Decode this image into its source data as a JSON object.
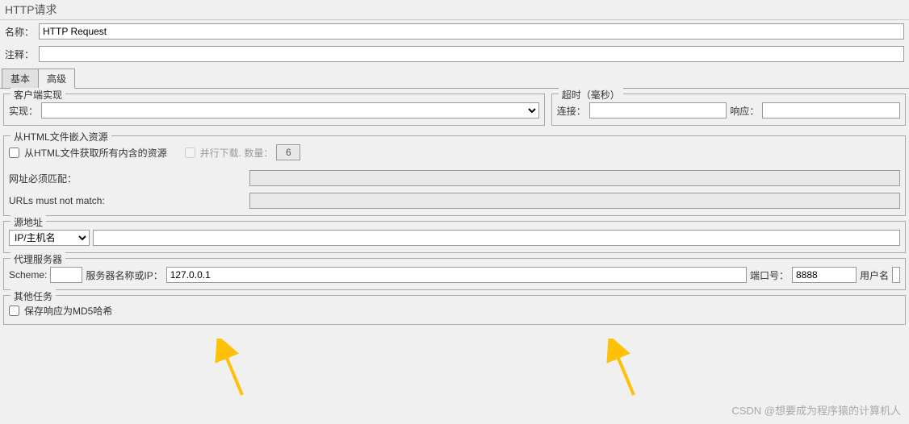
{
  "header": {
    "title": "HTTP请求"
  },
  "nameRow": {
    "label": "名称：",
    "value": "HTTP Request"
  },
  "commentRow": {
    "label": "注释：",
    "value": ""
  },
  "tabs": {
    "basic": "基本",
    "advanced": "高级"
  },
  "clientImpl": {
    "legend": "客户端实现",
    "implLabel": "实现：",
    "implValue": ""
  },
  "timeout": {
    "legend": "超时（毫秒）",
    "connectLabel": "连接：",
    "connectValue": "",
    "responseLabel": "响应：",
    "responseValue": ""
  },
  "htmlEmbed": {
    "legend": "从HTML文件嵌入资源",
    "cbRetrieve": "从HTML文件获取所有内含的资源",
    "cbParallel": "并行下载.  数量：",
    "parallelCount": "6",
    "urlMatchLabel": "网址必须匹配：",
    "urlMatchValue": "",
    "urlNotMatchLabel": "URLs must not match:",
    "urlNotMatchValue": ""
  },
  "sourceAddr": {
    "legend": "源地址",
    "dropdown": "IP/主机名",
    "value": ""
  },
  "proxy": {
    "legend": "代理服务器",
    "schemeLabel": "Scheme:",
    "schemeValue": "",
    "serverLabel": "服务器名称或IP：",
    "serverValue": "127.0.0.1",
    "portLabel": "端口号：",
    "portValue": "8888",
    "userLabel": "用户名",
    "userValue": ""
  },
  "otherTasks": {
    "legend": "其他任务",
    "cbMd5": "保存响应为MD5哈希"
  },
  "watermark": "CSDN @想要成为程序猿的计算机人"
}
